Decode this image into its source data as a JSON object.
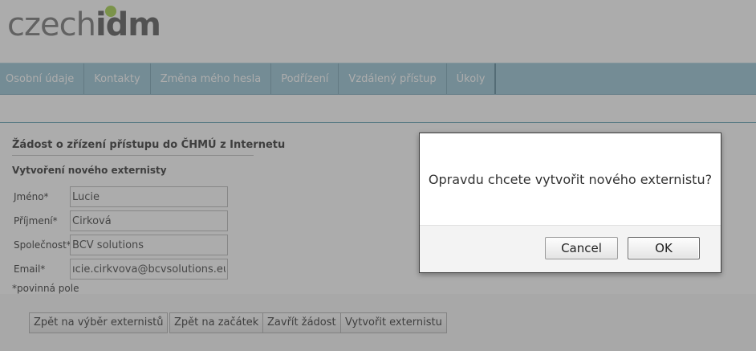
{
  "logo": {
    "part1": "czech",
    "part2": "idm"
  },
  "nav": {
    "items": [
      {
        "label": "Osobní údaje"
      },
      {
        "label": "Kontakty"
      },
      {
        "label": "Změna mého hesla"
      },
      {
        "label": "Podřízení"
      },
      {
        "label": "Vzdálený přístup"
      },
      {
        "label": "Úkoly"
      }
    ]
  },
  "form": {
    "title": "Žádost o zřízení přístupu do ČHMÚ z Internetu",
    "subtitle": "Vytvoření nového externisty",
    "fields": [
      {
        "label": "Jméno*",
        "value": "Lucie"
      },
      {
        "label": "Příjmení*",
        "value": "Cirková"
      },
      {
        "label": "Společnost*",
        "value": "BCV solutions"
      },
      {
        "label": "Email*",
        "value": "ıcie.cirkvova@bcvsolutions.eu"
      }
    ],
    "required_note": "*povinná pole",
    "buttons": {
      "back_to_selection": "Zpět na výběr externistů",
      "back_to_start": "Zpět na začátek",
      "close_request": "Zavřít žádost",
      "create_external": "Vytvořit externistu"
    }
  },
  "dialog": {
    "message": "Opravdu chcete vytvořit nového externistu?",
    "cancel_label": "Cancel",
    "ok_label": "OK"
  }
}
